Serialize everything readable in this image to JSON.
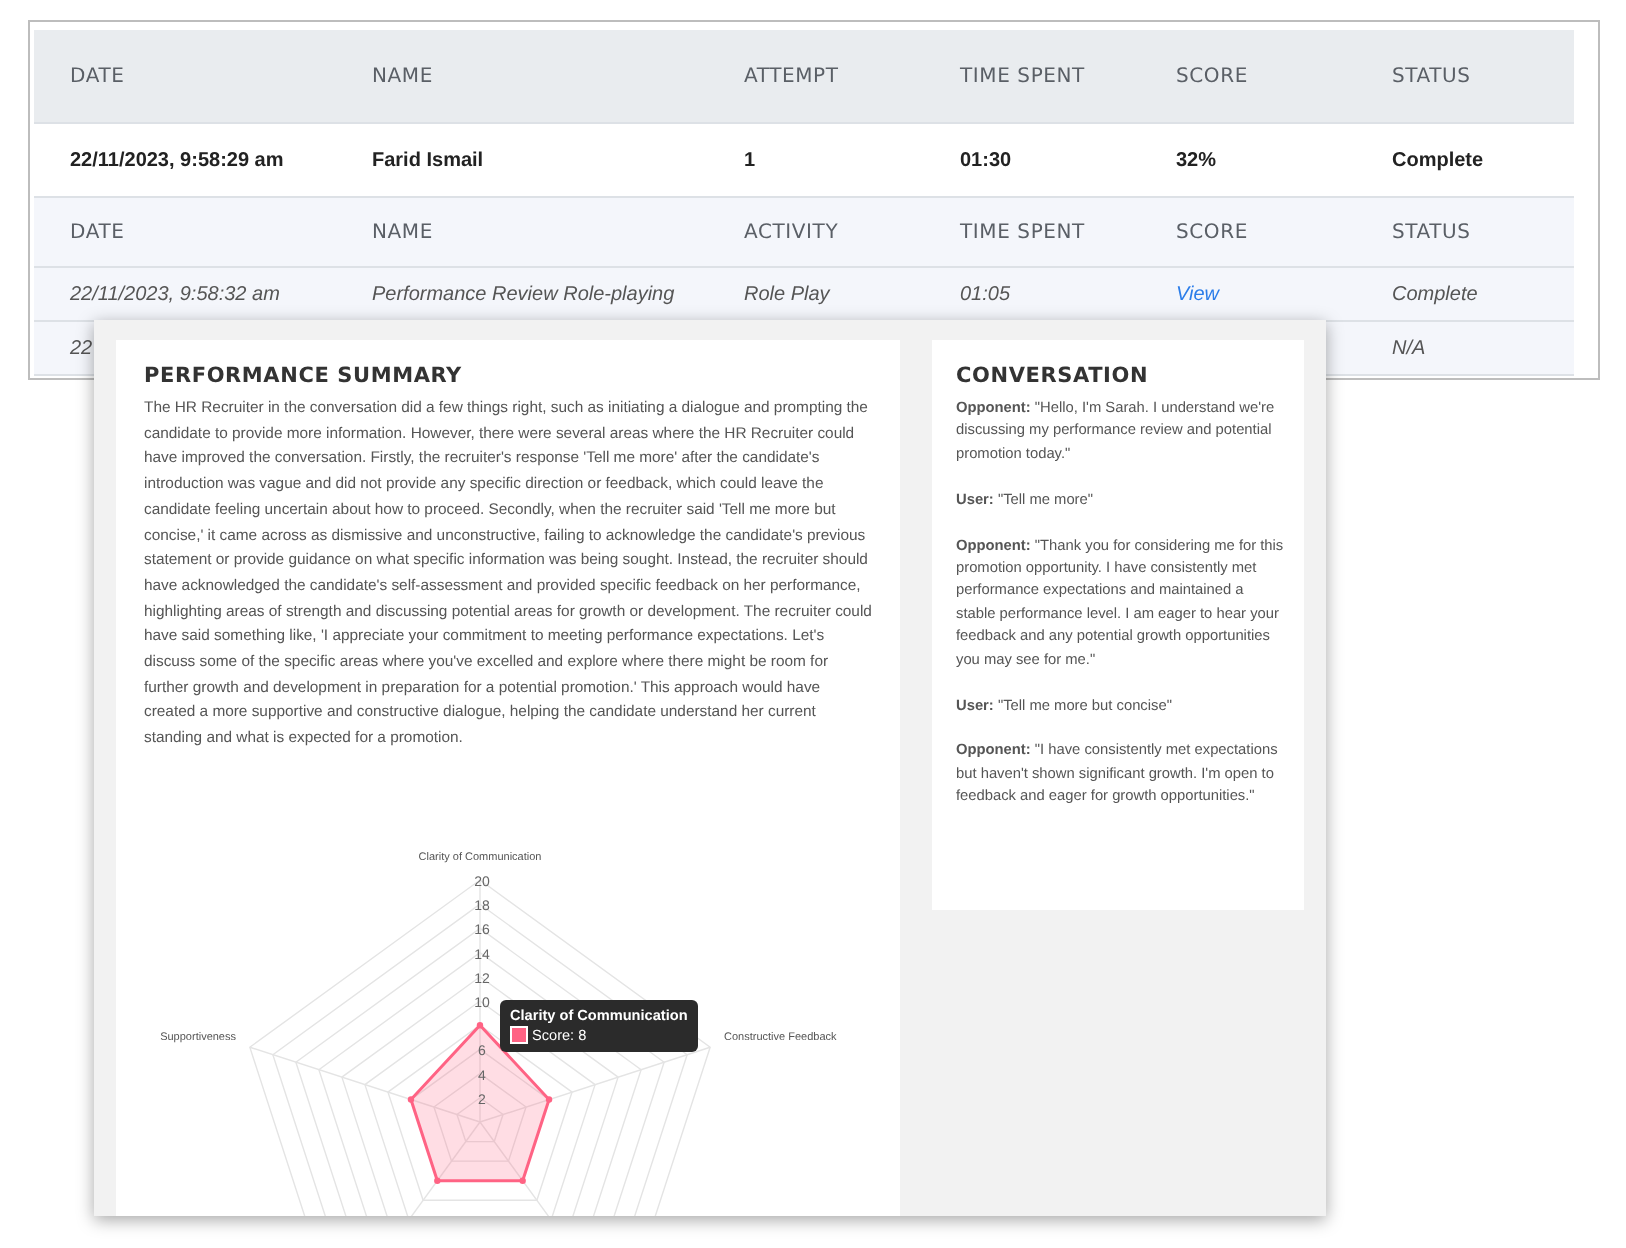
{
  "attempts": {
    "columns": [
      "DATE",
      "NAME",
      "ATTEMPT",
      "TIME SPENT",
      "SCORE",
      "STATUS"
    ],
    "rows": [
      {
        "date": "22/11/2023, 9:58:29 am",
        "name": "Farid Ismail",
        "attempt": "1",
        "time_spent": "01:30",
        "score": "32%",
        "status": "Complete"
      }
    ]
  },
  "activities": {
    "columns": [
      "DATE",
      "NAME",
      "ACTIVITY",
      "TIME SPENT",
      "SCORE",
      "STATUS"
    ],
    "rows": [
      {
        "date": "22/11/2023, 9:58:32 am",
        "name": "Performance Review Role-playing",
        "activity": "Role Play",
        "time_spent": "01:05",
        "score": "View",
        "status": "Complete"
      },
      {
        "date": "22",
        "status": "N/A"
      }
    ]
  },
  "summary": {
    "title": "PERFORMANCE SUMMARY",
    "text": "The HR Recruiter in the conversation did a few things right, such as initiating a dialogue and prompting the candidate to provide more information. However, there were several areas where the HR Recruiter could have improved the conversation. Firstly, the recruiter's response 'Tell me more' after the candidate's introduction was vague and did not provide any specific direction or feedback, which could leave the candidate feeling uncertain about how to proceed. Secondly, when the recruiter said 'Tell me more but concise,' it came across as dismissive and unconstructive, failing to acknowledge the candidate's previous statement or provide guidance on what specific information was being sought. Instead, the recruiter should have acknowledged the candidate's self-assessment and provided specific feedback on her performance, highlighting areas of strength and discussing potential areas for growth or development. The recruiter could have said something like, 'I appreciate your commitment to meeting performance expectations. Let's discuss some of the specific areas where you've excelled and explore where there might be room for further growth and development in preparation for a potential promotion.' This approach would have created a more supportive and constructive dialogue, helping the candidate understand her current standing and what is expected for a promotion.",
    "radar": {
      "axis_labels": [
        "Clarity of Communication",
        "Supportiveness",
        "Constructive Feedback"
      ],
      "upper_ticks": [
        "20",
        "18",
        "16",
        "14",
        "12",
        "10"
      ],
      "lower_ticks": [
        "6",
        "4",
        "2"
      ],
      "color": "#ff6384"
    },
    "tooltip": {
      "title": "Clarity of Communication",
      "label": "Score: 8"
    }
  },
  "conversation": {
    "title": "CONVERSATION",
    "messages": [
      "**Opponent:** \"Hello, I'm Sarah. I understand we're discussing my performance review and potential promotion today.\"",
      "**User:** \"Tell me more\"",
      "**Opponent:** \"Thank you for considering me for this promotion opportunity. I have consistently met performance expectations and maintained a stable performance level. I am eager to hear your feedback and any potential growth opportunities you may see for me.\"",
      "**User:** \"Tell me more but concise\"",
      "**Opponent:** \"I have consistently met expectations but haven't shown significant growth. I'm open to feedback and eager for growth opportunities.\""
    ]
  }
}
